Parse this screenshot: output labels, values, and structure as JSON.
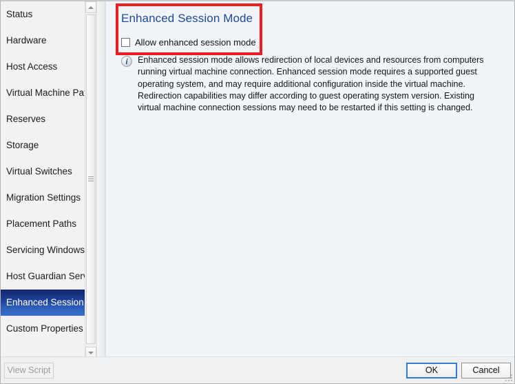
{
  "sidebar": {
    "items": [
      {
        "label": "Status",
        "selected": false
      },
      {
        "label": "Hardware",
        "selected": false
      },
      {
        "label": "Host Access",
        "selected": false
      },
      {
        "label": "Virtual Machine Paths",
        "selected": false
      },
      {
        "label": "Reserves",
        "selected": false
      },
      {
        "label": "Storage",
        "selected": false
      },
      {
        "label": "Virtual Switches",
        "selected": false
      },
      {
        "label": "Migration Settings",
        "selected": false
      },
      {
        "label": "Placement Paths",
        "selected": false
      },
      {
        "label": "Servicing Windows",
        "selected": false
      },
      {
        "label": "Host Guardian Service",
        "selected": false
      },
      {
        "label": "Enhanced Session",
        "selected": true
      },
      {
        "label": "Custom Properties",
        "selected": false
      }
    ],
    "scrollbar": {
      "up_arrow_icon": "chevron-up-icon",
      "down_arrow_icon": "chevron-down-icon",
      "thumb_grip_icon": "grip-lines-icon"
    }
  },
  "content": {
    "title": "Enhanced Session Mode",
    "checkbox": {
      "label": "Allow enhanced session mode",
      "checked": false
    },
    "info": {
      "icon": "info-circle-icon",
      "glyph": "i",
      "text": "Enhanced session mode allows redirection of local devices and resources from computers running virtual machine connection. Enhanced session mode requires a supported guest operating system, and may require additional configuration inside the virtual machine. Redirection capabilities may differ according to guest operating system version. Existing virtual machine connection sessions may need to be restarted if this setting is changed."
    }
  },
  "annotation": {
    "color": "#ef1c24",
    "shape": "rectangle-highlight"
  },
  "footer": {
    "view_script_label": "View Script",
    "ok_label": "OK",
    "cancel_label": "Cancel",
    "resize_grip_icon": "resize-grip-icon"
  },
  "colors": {
    "accent_blue": "#1b4a9c",
    "selected_nav_blue": "#1c3d93",
    "annotation_red": "#ef1c24",
    "content_background": "#f2f5f8",
    "sidebar_background": "#f2f2f3"
  }
}
